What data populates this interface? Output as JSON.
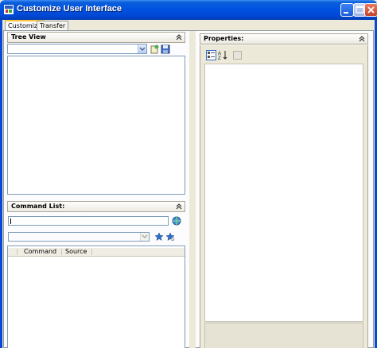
{
  "window": {
    "title": "Customize User Interface"
  },
  "tabs": [
    {
      "label": "Customize",
      "active": true
    },
    {
      "label": "Transfer",
      "active": false
    }
  ],
  "tree_view": {
    "title": "Tree View"
  },
  "command_list": {
    "title": "Command List:",
    "search_value": "",
    "filter_value": "",
    "columns": [
      "Command",
      "Source"
    ]
  },
  "properties": {
    "title": "Properties:"
  },
  "colors": {
    "title_bar": "#0054e3",
    "dialog_bg": "#ece9d8",
    "panel_bg": "#fcfcfe",
    "field_border": "#7f9db9"
  },
  "icons": {
    "app": "app-icon",
    "minimize": "minimize-icon",
    "maximize": "maximize-icon",
    "close": "close-icon",
    "tree_new": "new-file-icon",
    "tree_save": "save-icon",
    "search": "search-globe-icon",
    "favorite_add": "star-add-icon",
    "favorite": "star-icon",
    "categorized": "categorized-icon",
    "alphabetical": "sort-az-icon",
    "property_pages": "property-pages-icon"
  }
}
